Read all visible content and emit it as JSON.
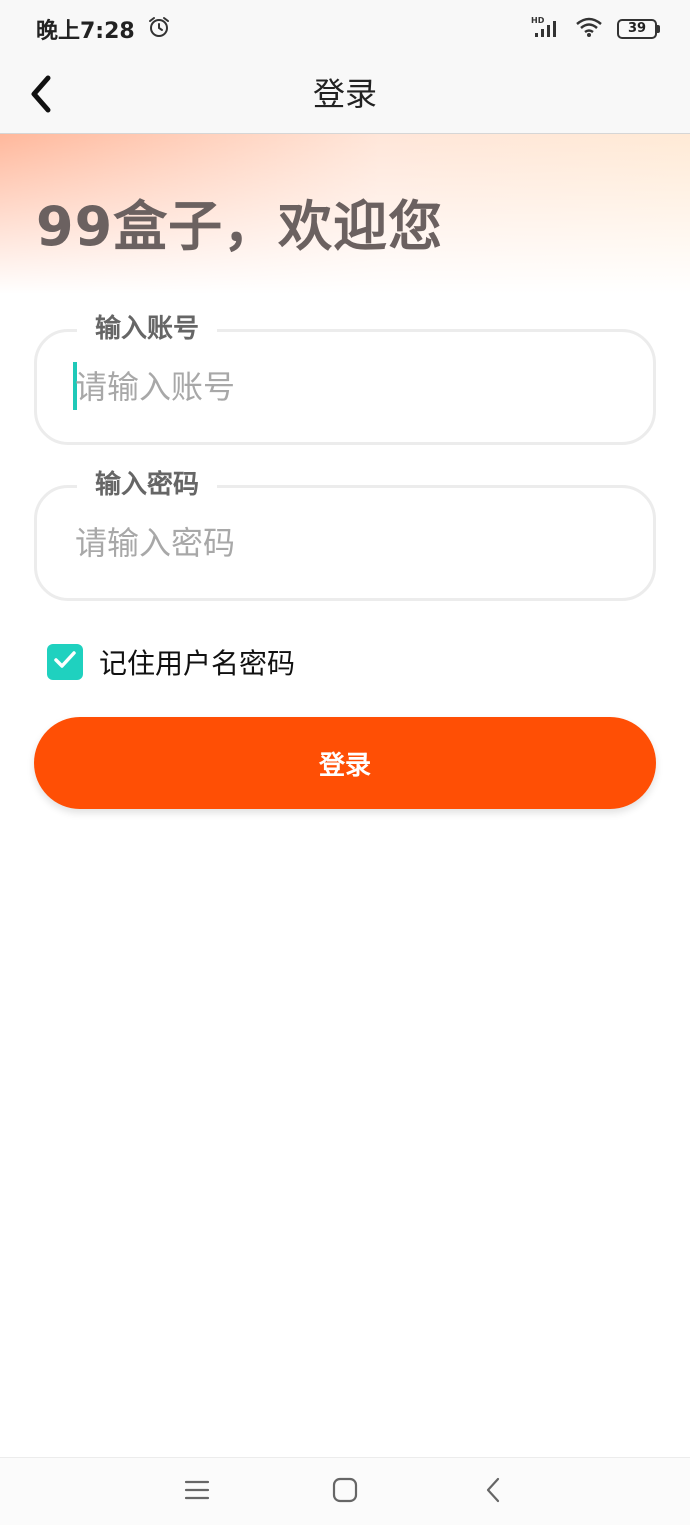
{
  "status_bar": {
    "time": "晚上7:28",
    "network": "HD",
    "battery": "39"
  },
  "nav": {
    "title": "登录",
    "back_icon": "chevron-left-icon"
  },
  "hero": {
    "title": "99盒子，欢迎您"
  },
  "form": {
    "account": {
      "legend": "输入账号",
      "placeholder": "请输入账号",
      "value": ""
    },
    "password": {
      "legend": "输入密码",
      "placeholder": "请输入密码",
      "value": ""
    },
    "remember": {
      "label": "记住用户名密码",
      "checked": true
    },
    "login_label": "登录"
  },
  "colors": {
    "accent": "#ff4f05",
    "checkbox": "#1fd1bf",
    "hero_text": "#6b6160"
  },
  "system_nav": {
    "icons": [
      "menu-icon",
      "home-icon",
      "back-icon"
    ]
  }
}
